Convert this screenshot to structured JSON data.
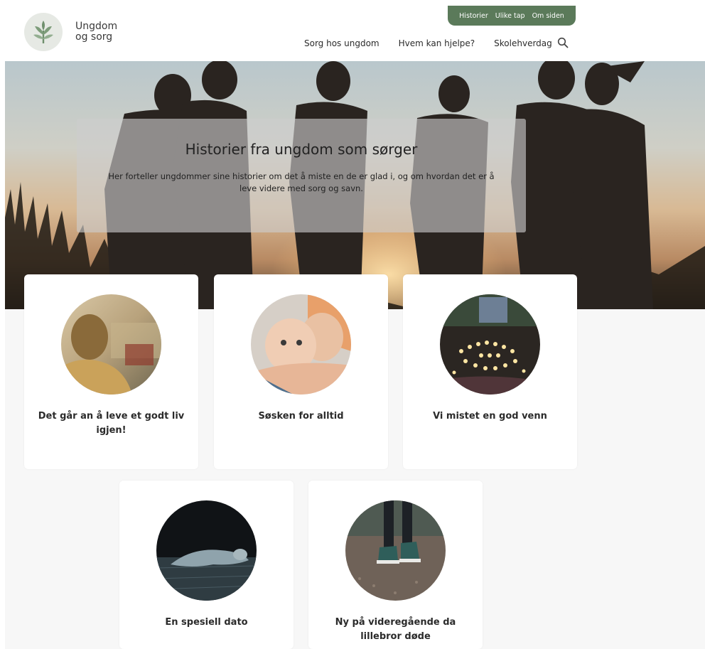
{
  "site": {
    "logo_line1": "Ungdom",
    "logo_line2": "og sorg"
  },
  "utility_nav": [
    "Historier",
    "Ulike tap",
    "Om siden"
  ],
  "main_nav": [
    "Sorg hos ungdom",
    "Hvem kan hjelpe?",
    "Skolehverdag"
  ],
  "search_icon": "search-icon",
  "hero": {
    "title": "Historier fra ungdom som sørger",
    "lead": "Her forteller ungdommer sine historier om det å miste en de er glad i, og om hvordan det er å leve videre med sorg og savn."
  },
  "cards": [
    {
      "title": "Det går an å leve et godt liv igjen!"
    },
    {
      "title": "Søsken for alltid"
    },
    {
      "title": "Vi mistet en god venn"
    },
    {
      "title": "En spesiell dato"
    },
    {
      "title": "Ny på videregående da lillebror døde"
    }
  ],
  "colors": {
    "accent_green": "#5b7a5a",
    "page_background": "#f7f7f7",
    "card_background": "#ffffff"
  }
}
